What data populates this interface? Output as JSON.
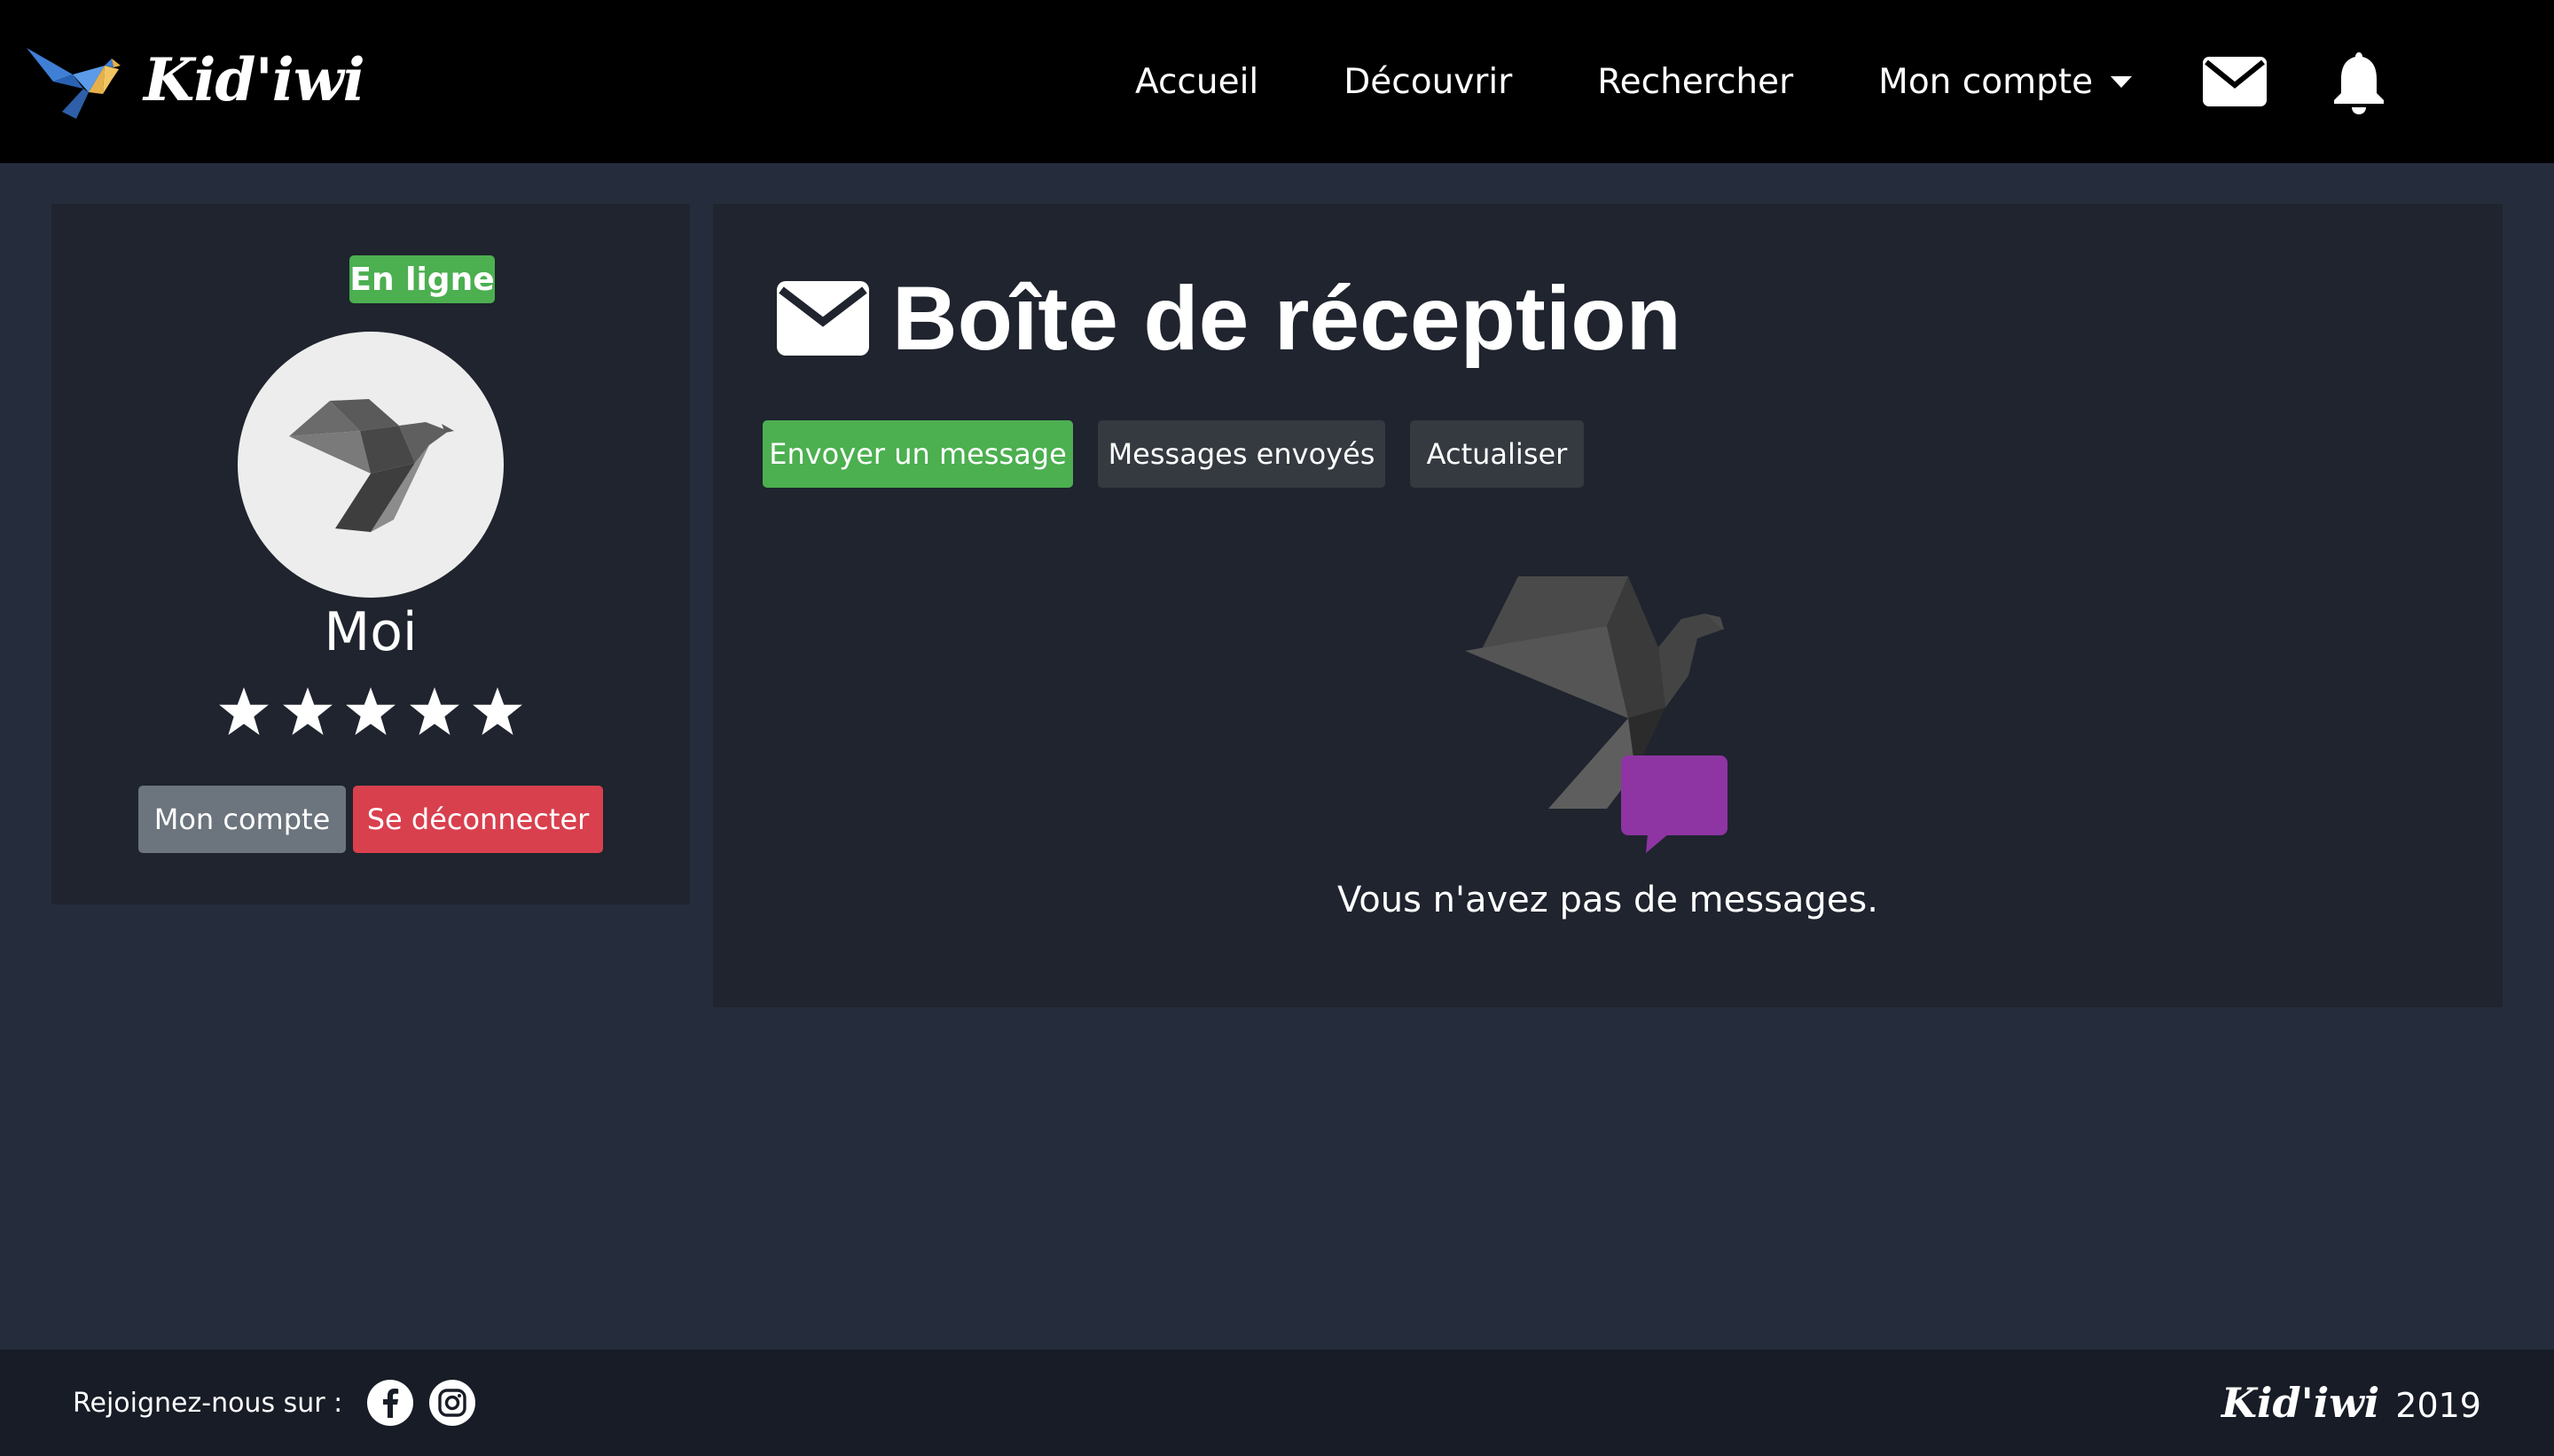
{
  "brand": {
    "name": "Kid'iwi"
  },
  "nav": {
    "items": [
      {
        "label": "Accueil"
      },
      {
        "label": "Découvrir"
      },
      {
        "label": "Rechercher"
      }
    ],
    "account_label": "Mon compte",
    "icons": [
      "envelope-icon",
      "bell-icon"
    ]
  },
  "profile": {
    "status": "En ligne",
    "name": "Moi",
    "rating": 5,
    "rating_max": 5,
    "account_button": "Mon compte",
    "logout_button": "Se déconnecter"
  },
  "inbox": {
    "title": "Boîte de réception",
    "actions": {
      "send": "Envoyer un message",
      "sent": "Messages envoyés",
      "refresh": "Actualiser"
    },
    "empty_text": "Vous n'avez pas de messages."
  },
  "footer": {
    "join_text": "Rejoignez-nous sur :",
    "social": [
      "facebook-icon",
      "instagram-icon"
    ],
    "brand": "Kid'iwi",
    "year": "2019"
  },
  "colors": {
    "navbar": "#000000",
    "background": "#252d3c",
    "panel": "#1f242e",
    "footer": "#171c26",
    "success": "#4caf50",
    "danger": "#d9404e",
    "secondary": "#6c757d",
    "dark_button": "#343a40",
    "message_bubble": "#8e35a3"
  }
}
